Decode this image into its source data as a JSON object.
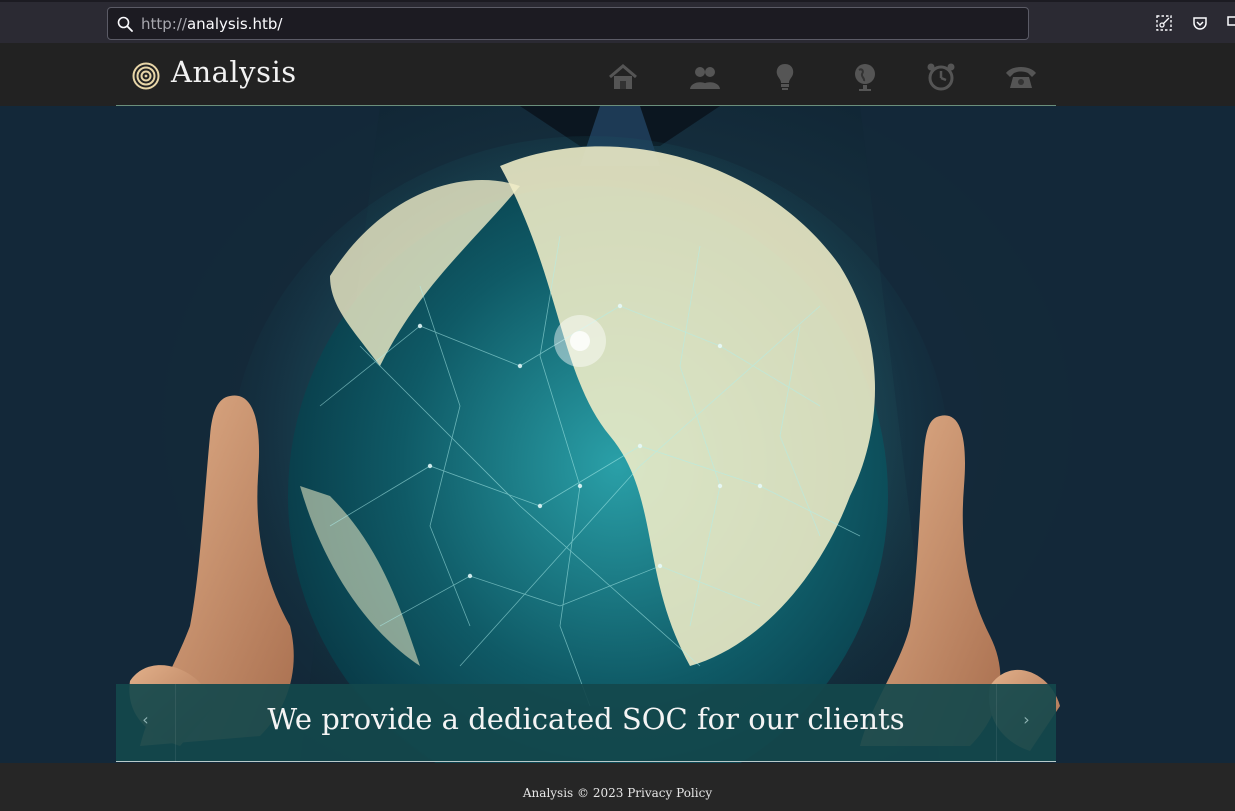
{
  "browser": {
    "url_protocol": "http://",
    "url_host": "analysis.htb/",
    "icons": [
      "search-icon",
      "screenshot-icon",
      "pocket-icon",
      "extensions-icon"
    ]
  },
  "site": {
    "brand": "Analysis",
    "logo_icon": "target-icon",
    "nav": [
      {
        "icon": "home-icon"
      },
      {
        "icon": "users-icon"
      },
      {
        "icon": "lightbulb-icon"
      },
      {
        "icon": "globe-icon"
      },
      {
        "icon": "alarm-clock-icon"
      },
      {
        "icon": "phone-icon"
      }
    ]
  },
  "hero": {
    "caption": "We provide a dedicated SOC for our clients",
    "prev_arrow": "‹",
    "next_arrow": "›"
  },
  "footer": {
    "text": "Analysis © 2023",
    "privacy_link": "Privacy Policy"
  },
  "colors": {
    "header_bg": "#222222",
    "caption_bg": "#14484c",
    "footer_bg": "#262626",
    "globe_cyan": "#5fd6d6",
    "globe_cream": "#f4f1d0"
  }
}
